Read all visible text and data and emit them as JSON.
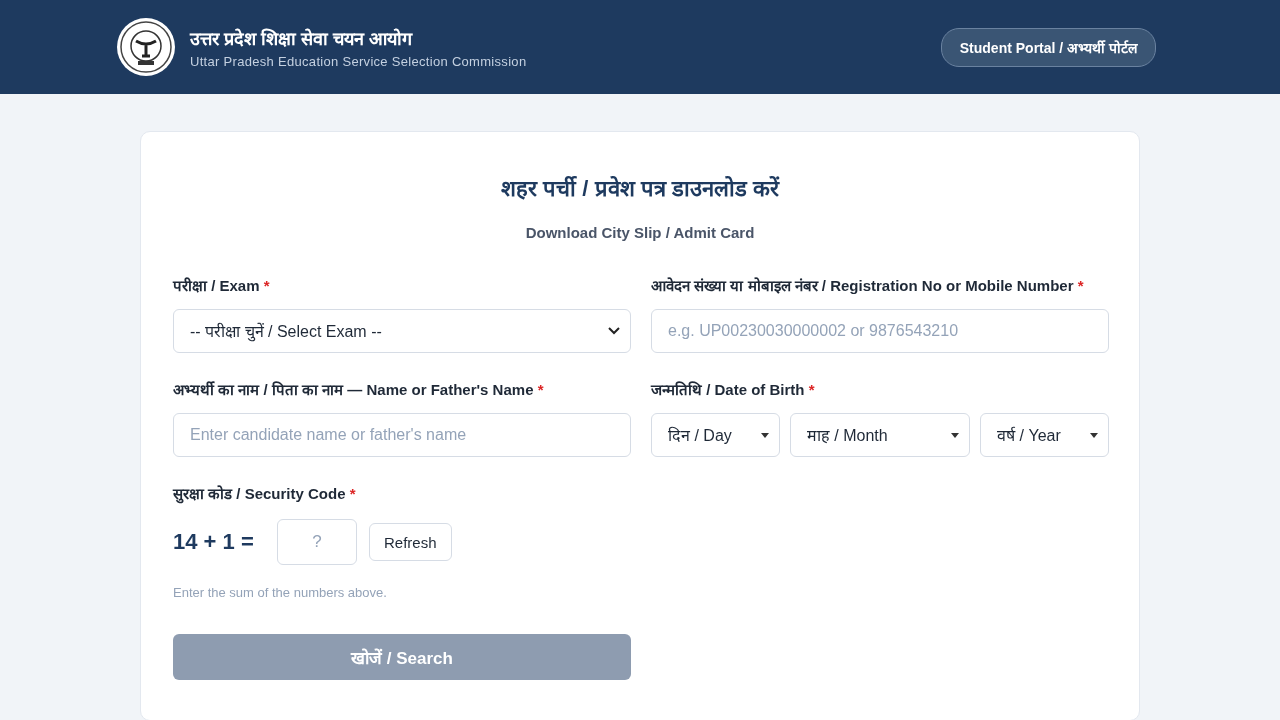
{
  "header": {
    "title": "उत्तर प्रदेश शिक्षा सेवा चयन आयोग",
    "subtitle": "Uttar Pradesh Education Service Selection Commission",
    "portal_button": "Student Portal / अभ्यर्थी पोर्टल"
  },
  "card": {
    "title": "शहर पर्ची / प्रवेश पत्र डाउनलोड करें",
    "subtitle": "Download City Slip / Admit Card"
  },
  "fields": [
    {
      "kind": "select",
      "label": "परीक्षा / Exam",
      "required_mark": "*",
      "value": "-- परीक्षा चुनें / Select Exam --"
    },
    {
      "kind": "input",
      "label": "आवेदन संख्या या मोबाइल नंबर / Registration No or Mobile Number",
      "required_mark": "*",
      "placeholder": "e.g. UP00230030000002 or 9876543210"
    },
    {
      "kind": "input",
      "label": "अभ्यर्थी का नाम / पिता का नाम — Name or Father's Name",
      "required_mark": "*",
      "placeholder": "Enter candidate name or father's name"
    },
    {
      "kind": "date",
      "label": "जन्मतिथि / Date of Birth",
      "required_mark": "*",
      "parts": [
        "दिन / Day",
        "माह / Month",
        "वर्ष / Year"
      ]
    }
  ],
  "security": {
    "label": "सुरक्षा कोड / Security Code",
    "required_mark": "*",
    "question": "14 + 1 =",
    "placeholder": "?",
    "refresh_button": "Refresh",
    "hint": "Enter the sum of the numbers above."
  },
  "search_button": {
    "label": "खोजें / Search",
    "disabled": true
  }
}
